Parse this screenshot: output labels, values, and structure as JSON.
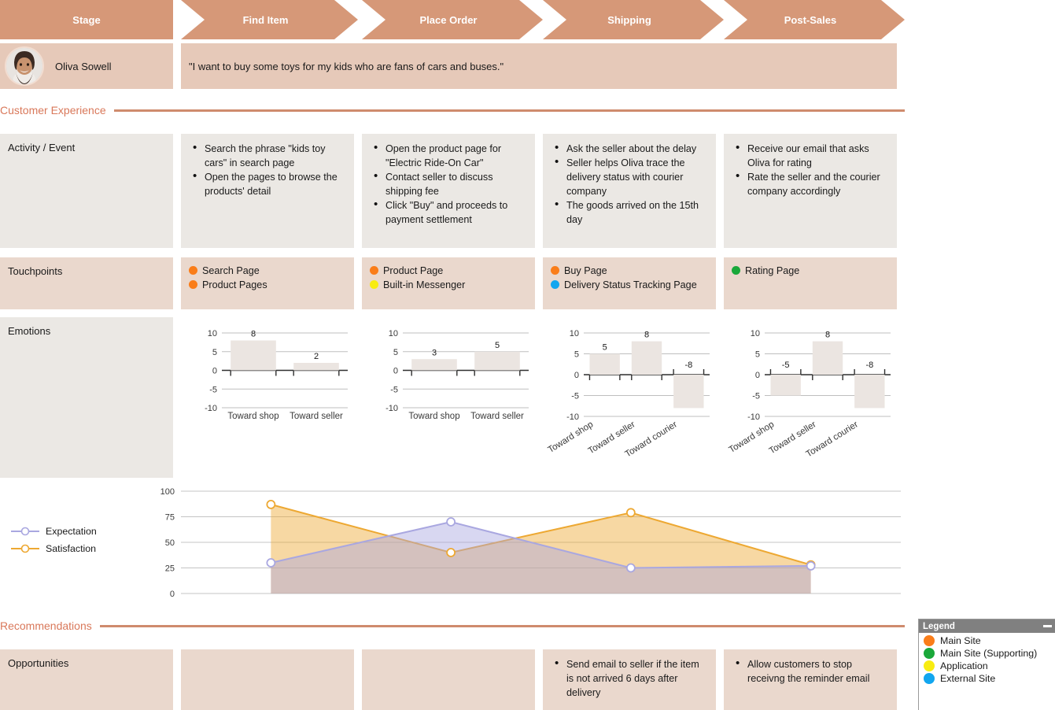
{
  "header": {
    "first_label": "Stage",
    "stages": [
      "Find Item",
      "Place Order",
      "Shipping",
      "Post-Sales"
    ]
  },
  "persona": {
    "name": "Oliva Sowell",
    "avatar": "person-avatar",
    "quote": "\"I want to buy some toys for my kids who are fans of cars and buses.\""
  },
  "sections": {
    "customer_experience": "Customer Experience",
    "recommendations": "Recommendations"
  },
  "rows": {
    "activity": {
      "label": "Activity / Event",
      "columns": [
        [
          "Search the phrase \"kids toy cars\" in search page",
          "Open the pages to browse the products' detail"
        ],
        [
          "Open the product page for \"Electric Ride-On Car\"",
          "Contact seller to discuss shipping fee",
          "Click \"Buy\" and proceeds to payment settlement"
        ],
        [
          "Ask the seller about the delay",
          "Seller helps Oliva trace the delivery status with courier company",
          "The goods arrived on the 15th day"
        ],
        [
          "Receive our email that asks Oliva for rating",
          "Rate the seller and the courier company accordingly"
        ]
      ]
    },
    "touchpoints": {
      "label": "Touchpoints",
      "columns": [
        [
          {
            "label": "Search Page",
            "color": "#fa7d19"
          },
          {
            "label": "Product Pages",
            "color": "#fa7d19"
          }
        ],
        [
          {
            "label": "Product Page",
            "color": "#fa7d19"
          },
          {
            "label": "Built-in Messenger",
            "color": "#f8ec11"
          }
        ],
        [
          {
            "label": "Buy Page",
            "color": "#fa7d19"
          },
          {
            "label": "Delivery Status Tracking Page",
            "color": "#12a6ef"
          }
        ],
        [
          {
            "label": "Rating Page",
            "color": "#1aa83a"
          }
        ]
      ]
    },
    "emotions": {
      "label": "Emotions"
    },
    "opportunities": {
      "label": "Opportunities",
      "columns": [
        [],
        [],
        [
          "Send email to seller if the item is not arrived 6 days after delivery"
        ],
        [
          "Allow customers to stop receivng the reminder email"
        ]
      ]
    }
  },
  "chart_data": [
    {
      "type": "bar",
      "title": "Emotions - Find Item",
      "categories": [
        "Toward shop",
        "Toward seller"
      ],
      "values": [
        8,
        2
      ],
      "ylim": [
        -10,
        10
      ],
      "yticks": [
        10,
        5,
        0,
        -5,
        -10
      ],
      "grid": true,
      "bar_color": "#ebe5e1"
    },
    {
      "type": "bar",
      "title": "Emotions - Place Order",
      "categories": [
        "Toward shop",
        "Toward seller"
      ],
      "values": [
        3,
        5
      ],
      "ylim": [
        -10,
        10
      ],
      "yticks": [
        10,
        5,
        0,
        -5,
        -10
      ],
      "grid": true,
      "bar_color": "#ebe5e1"
    },
    {
      "type": "bar",
      "title": "Emotions - Shipping",
      "categories": [
        "Toward shop",
        "Toward seller",
        "Toward courier"
      ],
      "values": [
        5,
        8,
        -8
      ],
      "ylim": [
        -10,
        10
      ],
      "yticks": [
        10,
        5,
        0,
        -5,
        -10
      ],
      "grid": true,
      "bar_color": "#ebe5e1"
    },
    {
      "type": "bar",
      "title": "Emotions - Post-Sales",
      "categories": [
        "Toward shop",
        "Toward seller",
        "Toward courier"
      ],
      "values": [
        -5,
        8,
        -8
      ],
      "ylim": [
        -10,
        10
      ],
      "yticks": [
        10,
        5,
        0,
        -5,
        -10
      ],
      "grid": true,
      "bar_color": "#ebe5e1"
    },
    {
      "type": "line",
      "title": "Expectation vs Satisfaction",
      "categories": [
        "Find Item",
        "Place Order",
        "Shipping",
        "Post-Sales"
      ],
      "ylim": [
        0,
        100
      ],
      "yticks": [
        100,
        75,
        50,
        25,
        0
      ],
      "grid": true,
      "legend_position": "left",
      "series": [
        {
          "name": "Expectation",
          "values": [
            30,
            70,
            25,
            27
          ],
          "color": "#a9a7e0"
        },
        {
          "name": "Satisfaction",
          "values": [
            87,
            40,
            79,
            28
          ],
          "color": "#eda832"
        }
      ]
    }
  ],
  "legend": {
    "title": "Legend",
    "minimize": "minimize-icon",
    "items": [
      {
        "label": "Main Site",
        "color": "#fa7d19"
      },
      {
        "label": "Main Site (Supporting)",
        "color": "#1aa83a"
      },
      {
        "label": "Application",
        "color": "#f8ec11"
      },
      {
        "label": "External Site",
        "color": "#12a6ef"
      }
    ]
  }
}
